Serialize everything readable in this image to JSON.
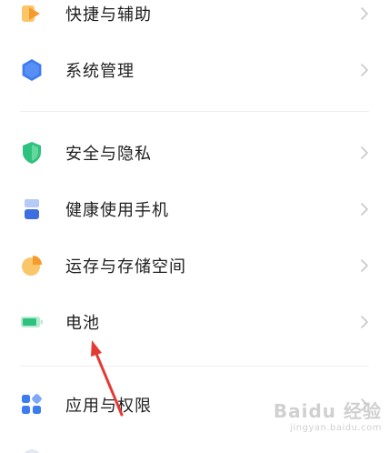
{
  "settings": {
    "items": [
      {
        "label": "快捷与辅助",
        "icon": "shortcut-accessibility-icon"
      },
      {
        "label": "系统管理",
        "icon": "system-management-icon"
      },
      {
        "label": "安全与隐私",
        "icon": "security-privacy-shield-icon"
      },
      {
        "label": "健康使用手机",
        "icon": "digital-wellbeing-hourglass-icon"
      },
      {
        "label": "运存与存储空间",
        "icon": "storage-pie-chart-icon"
      },
      {
        "label": "电池",
        "icon": "battery-icon"
      },
      {
        "label": "应用与权限",
        "icon": "apps-permissions-grid-icon"
      }
    ]
  },
  "watermark": {
    "text": "Baidu 经验",
    "sub": "jingyan.baidu.com"
  },
  "colors": {
    "orange": "#f7a53a",
    "blue": "#3d7bf0",
    "green": "#2ec27e",
    "red_arrow": "#e53935",
    "divider": "#eeeeee",
    "chevron": "#c8c8c8"
  }
}
